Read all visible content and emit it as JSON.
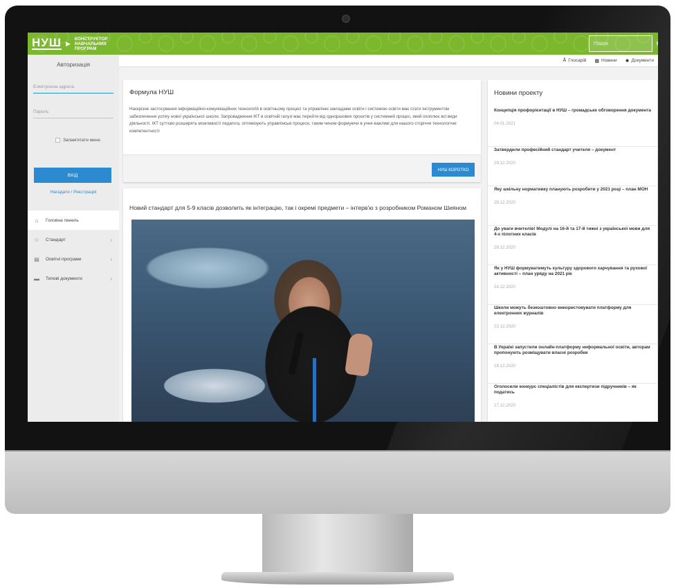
{
  "header": {
    "logo_mark": "НУШ",
    "logo_line1": "КОНСТРУКТОР",
    "logo_line2": "НАВЧАЛЬНИХ",
    "logo_line3": "ПРОГРАМ",
    "search_placeholder": "Пошук"
  },
  "topnav": {
    "glossary": "Глосарій",
    "news": "Новини",
    "documents": "Документи"
  },
  "auth": {
    "title": "Авторизація",
    "email_placeholder": "Електронна адреса",
    "password_placeholder": "Пароль",
    "remember": "Запам'ятати мене",
    "login": "ВХІД",
    "register": "Нагадати / Реєстрація"
  },
  "menu": [
    {
      "label": "Головна панель"
    },
    {
      "label": "Стандарт"
    },
    {
      "label": "Освітні програми"
    },
    {
      "label": "Типові документи"
    }
  ],
  "formula": {
    "title": "Формула НУШ",
    "body": "Наскрізне застосування інформаційно-комунікаційних технологій в освітньому процесі та управлінні закладами освіти і системою освіти має стати інструментом забезпечення успіху нової української школи. Запровадження ІКТ в освітній галузі має перейти від одноразових проєктів у системний процес, який охоплює всі види діяльності. ІКТ суттєво розширять можливості педагога, оптимізують управлінські процеси, таким чином формуючи в учня важливі для нашого сторіччя технологічні компетентності",
    "button": "НУШ КОРОТКО"
  },
  "article": {
    "title": "Новий стандарт для 5-9 класів дозволить як інтеграцію, так і окремі предмети – інтерв'ю з розробником Романом Шияном"
  },
  "news": {
    "header": "Новини проекту",
    "items": [
      {
        "title": "Концепція профорієнтації в НУШ – громадське обговорення документа",
        "date": "04.01.2021"
      },
      {
        "title": "Затвердили професійний стандарт учителя – документ",
        "date": "29.12.2020"
      },
      {
        "title": "Яку шкільну нормативку планують розробити у 2021 році – план МОН",
        "date": "28.12.2020"
      },
      {
        "title": "До уваги вчителів! Модулі на 16-й та 17-й тижні з української мови для 4-х пілотних класів",
        "date": "28.12.2020"
      },
      {
        "title": "Як у НУШ формуватимуть культуру здорового харчування та рухової активності – план уряду на 2021 рік",
        "date": "24.12.2020"
      },
      {
        "title": "Школи можуть безкоштовно використовувати платформу для електронних журналів",
        "date": "23.12.2020"
      },
      {
        "title": "В Україні запустили онлайн-платформу неформальної освіти, авторам пропонують розміщувати власні розробки",
        "date": "18.12.2020"
      },
      {
        "title": "Оголосили конкурс спеціалістів для експертизи підручників – як податись",
        "date": "17.12.2020"
      }
    ]
  },
  "colors": {
    "header_green": "#7bb82e",
    "accent_blue": "#2c8bd0"
  }
}
